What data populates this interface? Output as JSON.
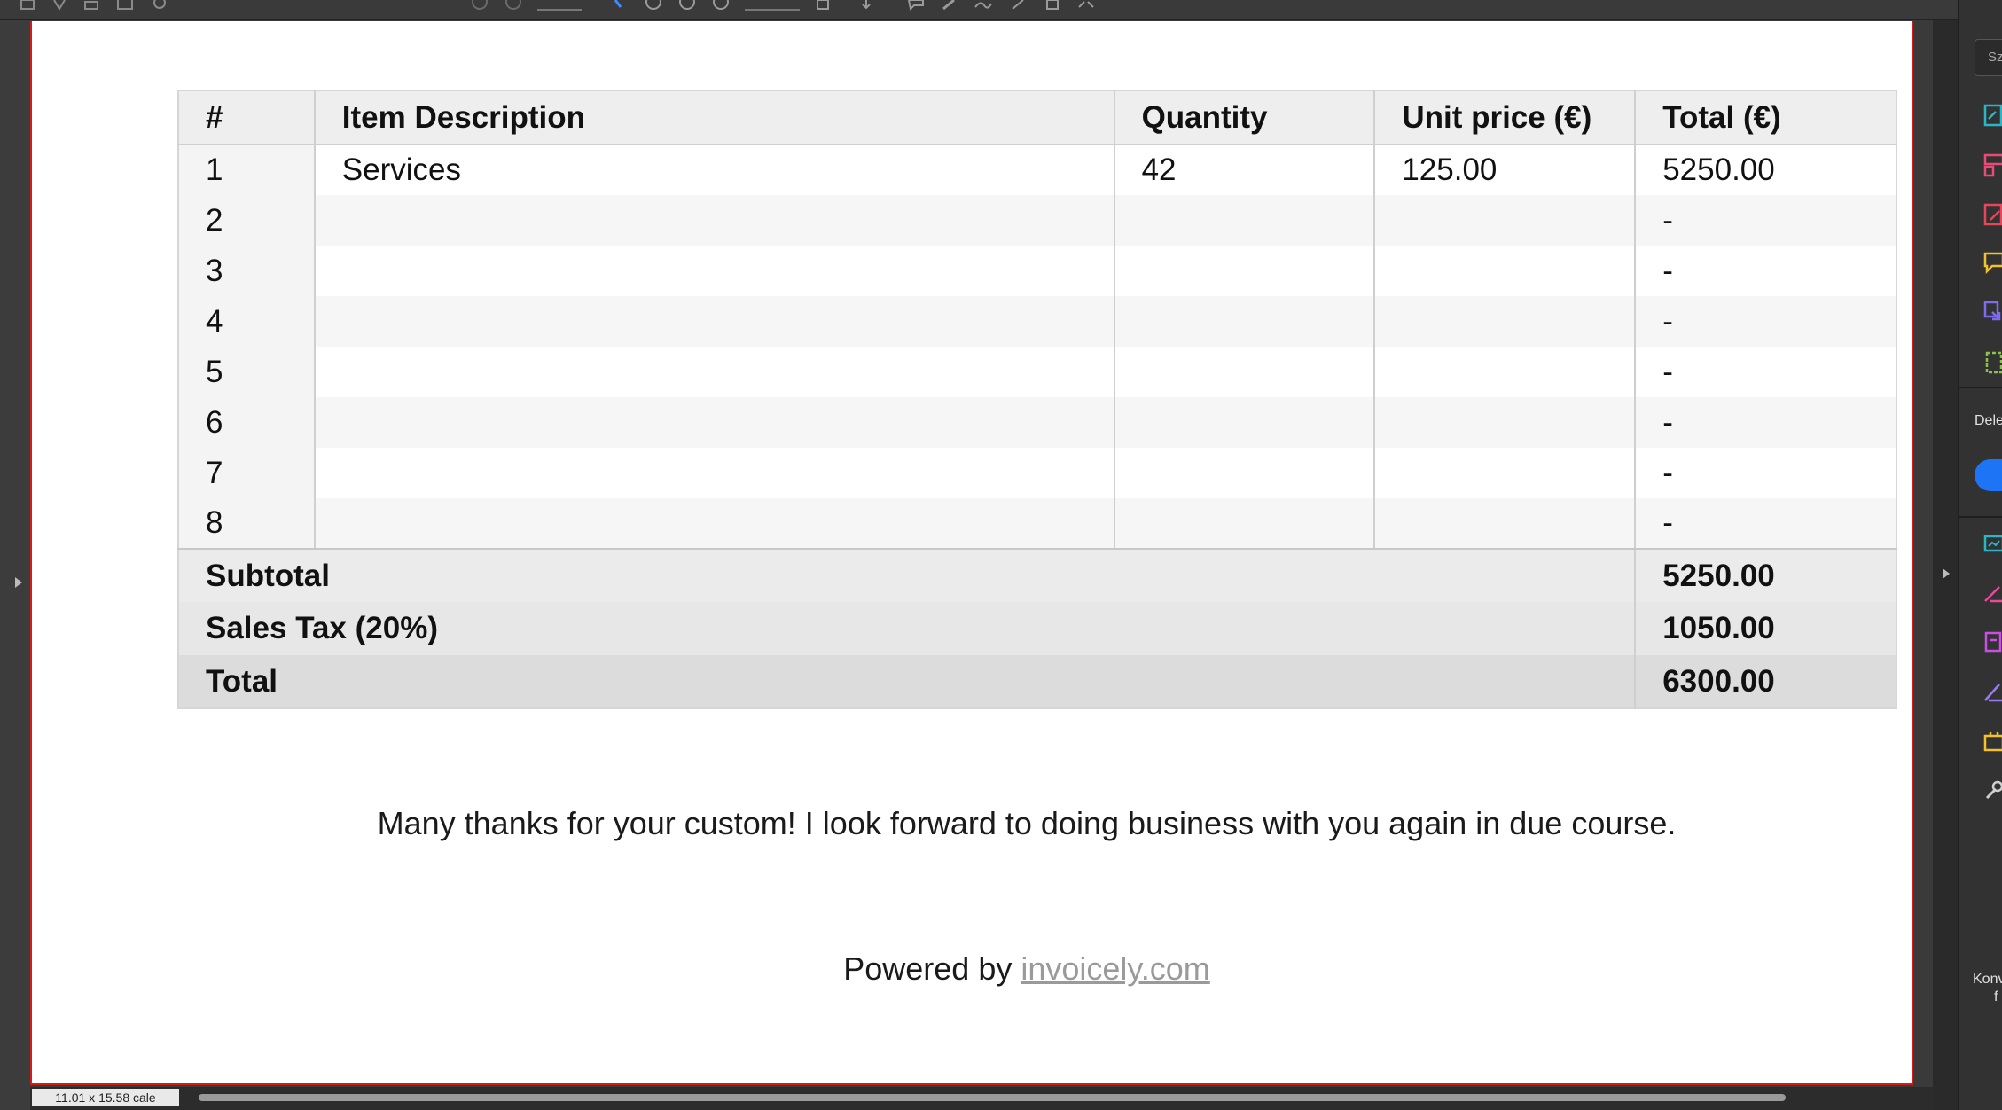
{
  "invoice": {
    "headers": [
      "#",
      "Item Description",
      "Quantity",
      "Unit price (€)",
      "Total (€)"
    ],
    "items": [
      {
        "num": "1",
        "description": "Services",
        "quantity": "42",
        "unit_price": "125.00",
        "total": "5250.00"
      },
      {
        "num": "2",
        "description": "",
        "quantity": "",
        "unit_price": "",
        "total": "-"
      },
      {
        "num": "3",
        "description": "",
        "quantity": "",
        "unit_price": "",
        "total": "-"
      },
      {
        "num": "4",
        "description": "",
        "quantity": "",
        "unit_price": "",
        "total": "-"
      },
      {
        "num": "5",
        "description": "",
        "quantity": "",
        "unit_price": "",
        "total": "-"
      },
      {
        "num": "6",
        "description": "",
        "quantity": "",
        "unit_price": "",
        "total": "-"
      },
      {
        "num": "7",
        "description": "",
        "quantity": "",
        "unit_price": "",
        "total": "-"
      },
      {
        "num": "8",
        "description": "",
        "quantity": "",
        "unit_price": "",
        "total": "-"
      }
    ],
    "summary": {
      "subtotal_label": "Subtotal",
      "subtotal_value": "5250.00",
      "tax_label": "Sales Tax (20%)",
      "tax_value": "1050.00",
      "total_label": "Total",
      "total_value": "6300.00"
    },
    "thanks_message": "Many thanks for your custom! I look forward to doing business with you again in due course.",
    "powered_prefix": "Powered by",
    "powered_link": "invoicely.com"
  },
  "status": {
    "page_size": "11.01 x 15.58 cale"
  },
  "right_pane": {
    "search_placeholder": "Sz",
    "section_label": "Dele",
    "convert_label_1": "Konv",
    "convert_label_2": "f"
  },
  "colors": {
    "page_border": "#d21b1b",
    "toggle_blue": "#1d74f5",
    "link_gray": "#9a9a9a"
  },
  "icons": {
    "toolbar": [
      "home-icon",
      "bookmark-icon",
      "print-icon",
      "mail-icon",
      "search-icon",
      "page-up-icon",
      "page-down-icon",
      "select-cursor-icon",
      "hand-icon",
      "zoom-out-icon",
      "zoom-in-icon",
      "fit-page-icon",
      "scroll-icon",
      "comment-icon",
      "highlight-icon",
      "sign-icon",
      "draw-icon",
      "delete-icon",
      "more-tools-icon"
    ],
    "right_pane": [
      "export-pdf-icon",
      "organize-pages-icon",
      "edit-pdf-icon",
      "comment-tool-icon",
      "combine-files-icon",
      "compress-icon",
      "fill-sign-icon",
      "protect-icon",
      "request-signature-icon",
      "draw-tool-icon",
      "scan-icon",
      "more-tools-icon"
    ]
  }
}
